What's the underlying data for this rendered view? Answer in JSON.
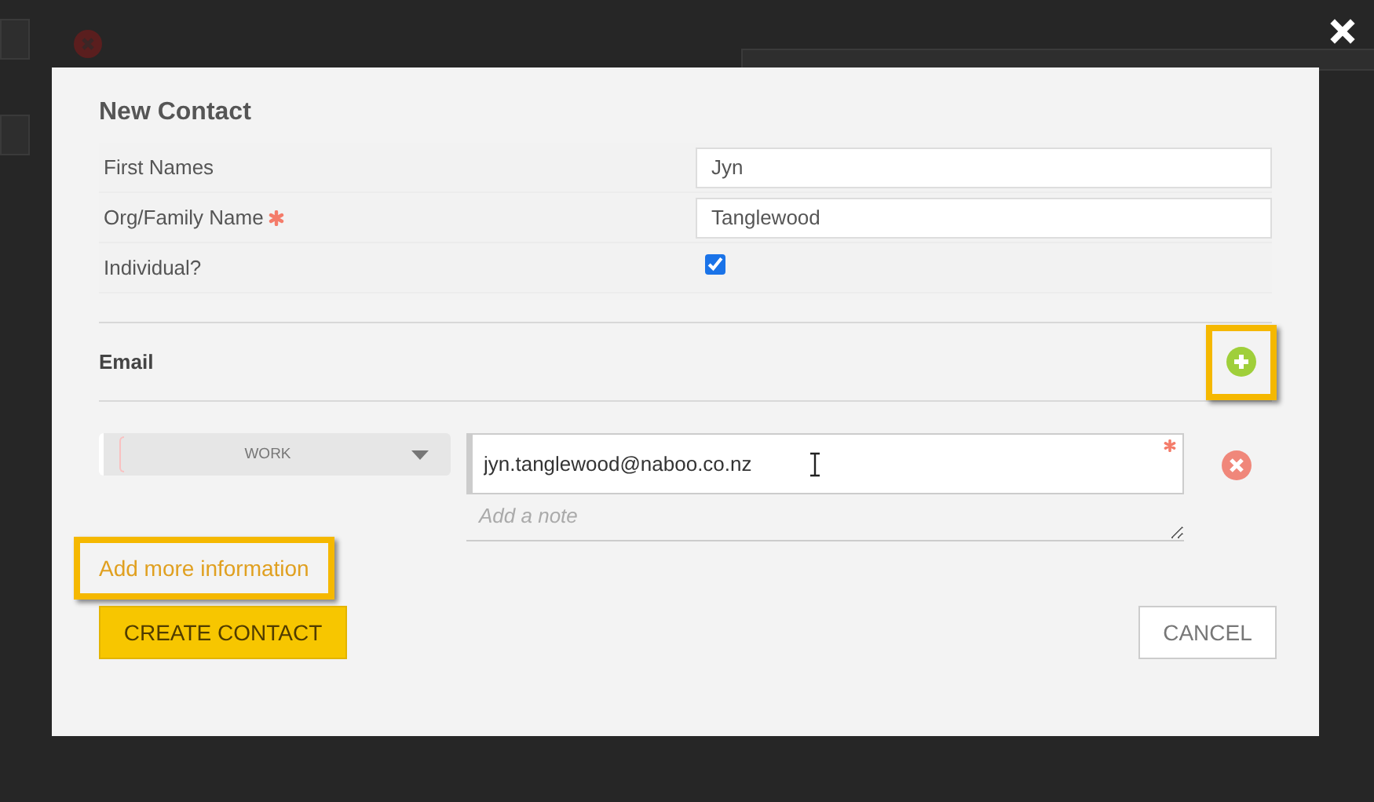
{
  "dialog": {
    "title": "New Contact",
    "fields": [
      {
        "kind": "text",
        "label": "First Names",
        "required": false,
        "value": "Jyn"
      },
      {
        "kind": "text",
        "label": "Org/Family Name",
        "required": true,
        "value": "Tanglewood"
      },
      {
        "kind": "checkbox",
        "label": "Individual?",
        "required": false,
        "checked": true
      }
    ],
    "email_section": {
      "title": "Email",
      "add_highlighted": true,
      "entries": [
        {
          "type": "WORK",
          "value": "jyn.tanglewood@naboo.co.nz",
          "required": true,
          "note_placeholder": "Add a note"
        }
      ]
    },
    "more_link": {
      "label": "Add more information",
      "highlighted": true
    },
    "buttons": [
      {
        "kind": "primary",
        "label": "CREATE CONTACT"
      },
      {
        "kind": "secondary",
        "label": "CANCEL"
      }
    ]
  }
}
